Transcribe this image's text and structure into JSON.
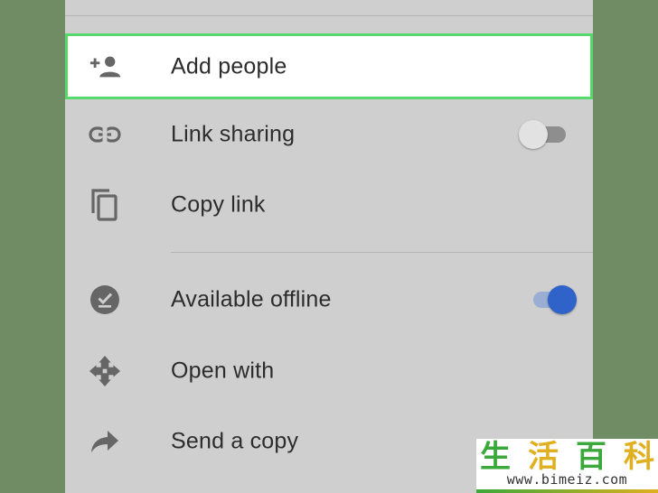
{
  "menu": {
    "items": [
      {
        "label": "Add people",
        "icon": "person-add-icon",
        "highlighted": true
      },
      {
        "label": "Link sharing",
        "icon": "link-icon",
        "toggle": "off"
      },
      {
        "label": "Copy link",
        "icon": "copy-icon"
      },
      {
        "label": "Available offline",
        "icon": "offline-check-icon",
        "toggle": "on"
      },
      {
        "label": "Open with",
        "icon": "open-with-icon"
      },
      {
        "label": "Send a copy",
        "icon": "share-arrow-icon"
      }
    ]
  },
  "watermark": {
    "chars": [
      "生",
      "活",
      "百",
      "科"
    ],
    "url": "www.bimeiz.com"
  },
  "colors": {
    "background": "#708c65",
    "sheet": "#cfcfcf",
    "highlight_border": "#56d86a",
    "toggle_on": "#2f63c9",
    "icon": "#666666",
    "text": "#2c2c2c"
  }
}
